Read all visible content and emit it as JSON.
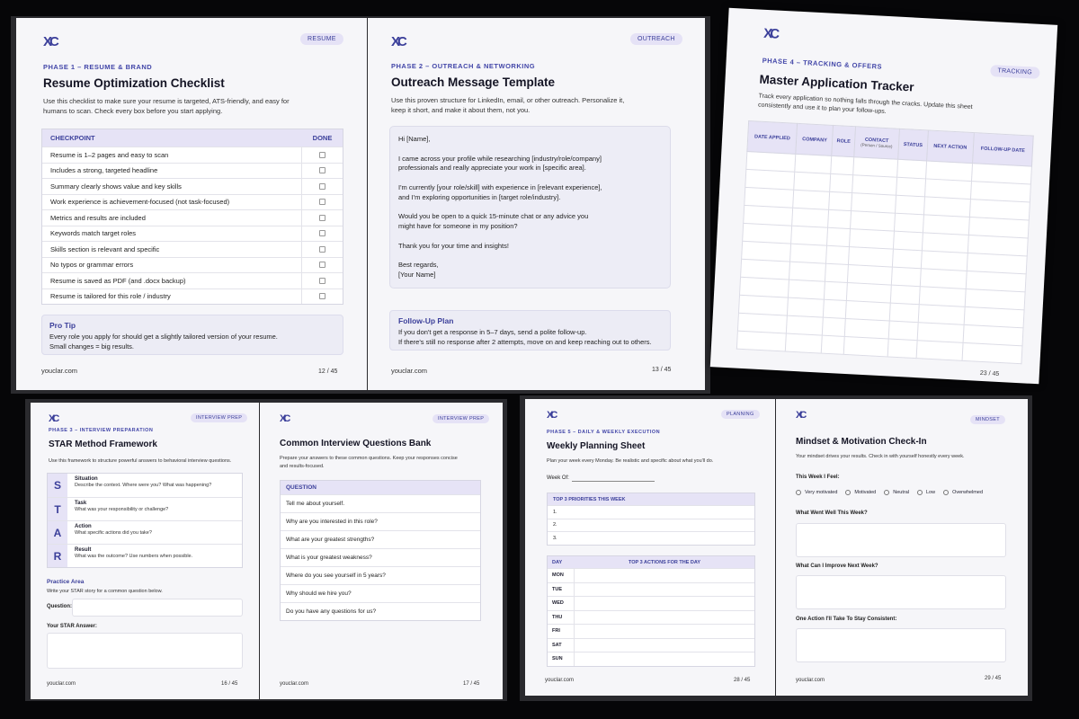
{
  "brand": {
    "logo": "XC",
    "site": "youclar.com"
  },
  "colors": {
    "accent": "#3b3f9a",
    "header_bg": "#e6e3f6",
    "background": "#060608"
  },
  "resume": {
    "tag": "RESUME",
    "phase": "PHASE 1 – RESUME & BRAND",
    "title": "Resume Optimization Checklist",
    "intro_1": "Use this checklist to make sure your resume is targeted, ATS-friendly, and easy for",
    "intro_2": "humans to scan. Check every box before you start applying.",
    "col_checkpoint": "CHECKPOINT",
    "col_done": "DONE",
    "items": [
      "Resume is 1–2 pages and easy to scan",
      "Includes a strong, targeted headline",
      "Summary clearly shows value and key skills",
      "Work experience is achievement-focused (not task-focused)",
      "Metrics and results are included",
      "Keywords match target roles",
      "Skills section is relevant and specific",
      "No typos or grammar errors",
      "Resume is saved as PDF (and .docx backup)",
      "Resume is tailored for this role / industry"
    ],
    "tip_title": "Pro Tip",
    "tip_1": "Every role you apply for should get a slightly tailored version of your resume.",
    "tip_2": "Small changes = big results.",
    "page": "12 / 45"
  },
  "outreach": {
    "tag": "OUTREACH",
    "phase": "PHASE 2 – OUTREACH & NETWORKING",
    "title": "Outreach Message Template",
    "intro_1": "Use this proven structure for LinkedIn, email, or other outreach. Personalize it,",
    "intro_2": "keep it short, and make it about them, not you.",
    "msg_1": "Hi [Name],",
    "msg_2a": "I came across your profile while researching [industry/role/company]",
    "msg_2b": "professionals and really appreciate your work in [specific area].",
    "msg_3a": "I'm currently [your role/skill] with experience in [relevant experience],",
    "msg_3b": "and I'm exploring opportunities in [target role/industry].",
    "msg_4a": "Would you be open to a quick 15-minute chat or any advice you",
    "msg_4b": "might have for someone in my position?",
    "msg_5": "Thank you for your time and insights!",
    "msg_6a": "Best regards,",
    "msg_6b": "[Your Name]",
    "follow_title": "Follow-Up Plan",
    "follow_1": "If you don't get a response in 5–7 days, send a polite follow-up.",
    "follow_2": "If there's still no response after 2 attempts, move on and keep reaching out to others.",
    "page": "13 / 45"
  },
  "tracker": {
    "tag": "TRACKING",
    "phase": "PHASE 4 – TRACKING & OFFERS",
    "title": "Master Application Tracker",
    "intro_1": "Track every application so nothing falls through the cracks. Update this sheet",
    "intro_2": "consistently and use it to plan your follow-ups.",
    "cols": [
      "DATE APPLIED",
      "COMPANY",
      "ROLE",
      "CONTACT",
      "STATUS",
      "NEXT ACTION",
      "FOLLOW-UP DATE"
    ],
    "contact_sub": "(Person / Source)",
    "page": "23 / 45"
  },
  "star": {
    "tag": "INTERVIEW PREP",
    "phase": "PHASE 3 – INTERVIEW PREPARATION",
    "title": "STAR Method Framework",
    "intro": "Use this framework to structure powerful answers to behavioral interview questions.",
    "rows": [
      {
        "letter": "S",
        "name": "Situation",
        "desc": "Describe the context. Where were you? What was happening?"
      },
      {
        "letter": "T",
        "name": "Task",
        "desc": "What was your responsibility or challenge?"
      },
      {
        "letter": "A",
        "name": "Action",
        "desc": "What specific actions did you take?"
      },
      {
        "letter": "R",
        "name": "Result",
        "desc": "What was the outcome? Use numbers when possible."
      }
    ],
    "practice_title": "Practice Area",
    "practice_intro": "Write your STAR story for a common question below.",
    "question_label": "Question:",
    "answer_label": "Your STAR Answer:",
    "page": "16 / 45"
  },
  "questions": {
    "tag": "INTERVIEW PREP",
    "title": "Common Interview Questions Bank",
    "intro_1": "Prepare your answers to these common questions. Keep your responses concise",
    "intro_2": "and results-focused.",
    "col": "QUESTION",
    "items": [
      "Tell me about yourself.",
      "Why are you interested in this role?",
      "What are your greatest strengths?",
      "What is your greatest weakness?",
      "Where do you see yourself in 5 years?",
      "Why should we hire you?",
      "Do you have any questions for us?"
    ],
    "page": "17 / 45"
  },
  "planning": {
    "tag": "PLANNING",
    "phase": "PHASE 5 – DAILY & WEEKLY EXECUTION",
    "title": "Weekly Planning Sheet",
    "intro": "Plan your week every Monday. Be realistic and specific about what you'll do.",
    "week_label": "Week Of:",
    "priorities_title": "TOP 3 PRIORITIES THIS WEEK",
    "priorities": [
      "1.",
      "2.",
      "3."
    ],
    "col_day": "DAY",
    "col_actions": "TOP 3 ACTIONS FOR THE DAY",
    "days": [
      "MON",
      "TUE",
      "WED",
      "THU",
      "FRI",
      "SAT",
      "SUN"
    ],
    "page": "28 / 45"
  },
  "mindset": {
    "tag": "MINDSET",
    "title": "Mindset & Motivation Check-In",
    "intro": "Your mindset drives your results. Check in with yourself honestly every week.",
    "feel_label": "This Week I Feel:",
    "options": [
      "Very motivated",
      "Motivated",
      "Neutral",
      "Low",
      "Overwhelmed"
    ],
    "q1": "What Went Well This Week?",
    "q2": "What Can I Improve Next Week?",
    "q3": "One Action I'll Take To Stay Consistent:",
    "page": "29 / 45"
  }
}
